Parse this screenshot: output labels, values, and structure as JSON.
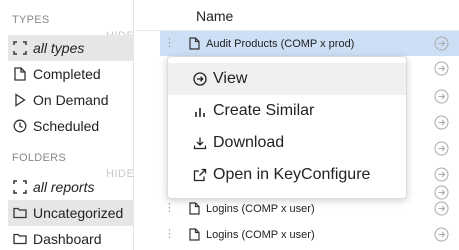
{
  "sidebar": {
    "types_header": "TYPES",
    "types_hide": "HIDE",
    "types": [
      {
        "label": "all types",
        "icon": "dashed-square-icon",
        "selected": true
      },
      {
        "label": "Completed",
        "icon": "document-icon",
        "selected": false
      },
      {
        "label": "On Demand",
        "icon": "play-triangle-icon",
        "selected": false
      },
      {
        "label": "Scheduled",
        "icon": "clock-icon",
        "selected": false
      }
    ],
    "folders_header": "FOLDERS",
    "folders_hide": "HIDE",
    "folders": [
      {
        "label": "all reports",
        "icon": "dashed-square-icon",
        "selected": false
      },
      {
        "label": "Uncategorized",
        "icon": "folder-icon",
        "selected": true
      },
      {
        "label": "Dashboard",
        "icon": "folder-icon",
        "selected": false
      }
    ]
  },
  "list": {
    "column_header": "Name",
    "rows": [
      {
        "name": "Audit Products (COMP x prod)",
        "selected": true
      },
      {
        "name": "",
        "selected": false
      },
      {
        "name": "",
        "selected": false
      },
      {
        "name": "",
        "selected": false
      },
      {
        "name": "",
        "selected": false
      },
      {
        "name": "",
        "selected": false
      },
      {
        "name": "",
        "selected": false
      },
      {
        "name": "Logins (COMP x user)",
        "selected": false
      },
      {
        "name": "Logins (COMP x user)",
        "selected": false
      }
    ]
  },
  "context_menu": {
    "items": [
      {
        "label": "View",
        "icon": "arrow-circle-right-icon"
      },
      {
        "label": "Create Similar",
        "icon": "bar-chart-icon"
      },
      {
        "label": "Download",
        "icon": "download-icon"
      },
      {
        "label": "Open in KeyConfigure",
        "icon": "external-link-icon"
      }
    ]
  },
  "colors": {
    "selected_row": "#cddff5",
    "sidebar_selected": "#e6e6e6",
    "menu_hover": "#f0f0f0"
  }
}
